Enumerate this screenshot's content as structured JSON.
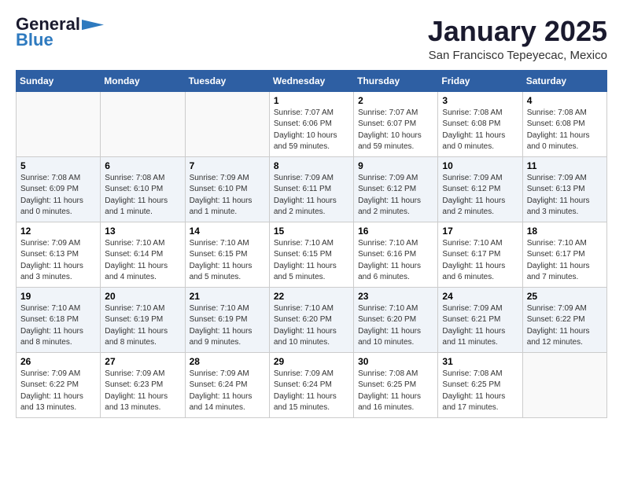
{
  "header": {
    "logo_line1": "General",
    "logo_line2": "Blue",
    "month": "January 2025",
    "location": "San Francisco Tepeyecac, Mexico"
  },
  "days_of_week": [
    "Sunday",
    "Monday",
    "Tuesday",
    "Wednesday",
    "Thursday",
    "Friday",
    "Saturday"
  ],
  "weeks": [
    [
      {
        "day": "",
        "info": ""
      },
      {
        "day": "",
        "info": ""
      },
      {
        "day": "",
        "info": ""
      },
      {
        "day": "1",
        "info": "Sunrise: 7:07 AM\nSunset: 6:06 PM\nDaylight: 10 hours\nand 59 minutes."
      },
      {
        "day": "2",
        "info": "Sunrise: 7:07 AM\nSunset: 6:07 PM\nDaylight: 10 hours\nand 59 minutes."
      },
      {
        "day": "3",
        "info": "Sunrise: 7:08 AM\nSunset: 6:08 PM\nDaylight: 11 hours\nand 0 minutes."
      },
      {
        "day": "4",
        "info": "Sunrise: 7:08 AM\nSunset: 6:08 PM\nDaylight: 11 hours\nand 0 minutes."
      }
    ],
    [
      {
        "day": "5",
        "info": "Sunrise: 7:08 AM\nSunset: 6:09 PM\nDaylight: 11 hours\nand 0 minutes."
      },
      {
        "day": "6",
        "info": "Sunrise: 7:08 AM\nSunset: 6:10 PM\nDaylight: 11 hours\nand 1 minute."
      },
      {
        "day": "7",
        "info": "Sunrise: 7:09 AM\nSunset: 6:10 PM\nDaylight: 11 hours\nand 1 minute."
      },
      {
        "day": "8",
        "info": "Sunrise: 7:09 AM\nSunset: 6:11 PM\nDaylight: 11 hours\nand 2 minutes."
      },
      {
        "day": "9",
        "info": "Sunrise: 7:09 AM\nSunset: 6:12 PM\nDaylight: 11 hours\nand 2 minutes."
      },
      {
        "day": "10",
        "info": "Sunrise: 7:09 AM\nSunset: 6:12 PM\nDaylight: 11 hours\nand 2 minutes."
      },
      {
        "day": "11",
        "info": "Sunrise: 7:09 AM\nSunset: 6:13 PM\nDaylight: 11 hours\nand 3 minutes."
      }
    ],
    [
      {
        "day": "12",
        "info": "Sunrise: 7:09 AM\nSunset: 6:13 PM\nDaylight: 11 hours\nand 3 minutes."
      },
      {
        "day": "13",
        "info": "Sunrise: 7:10 AM\nSunset: 6:14 PM\nDaylight: 11 hours\nand 4 minutes."
      },
      {
        "day": "14",
        "info": "Sunrise: 7:10 AM\nSunset: 6:15 PM\nDaylight: 11 hours\nand 5 minutes."
      },
      {
        "day": "15",
        "info": "Sunrise: 7:10 AM\nSunset: 6:15 PM\nDaylight: 11 hours\nand 5 minutes."
      },
      {
        "day": "16",
        "info": "Sunrise: 7:10 AM\nSunset: 6:16 PM\nDaylight: 11 hours\nand 6 minutes."
      },
      {
        "day": "17",
        "info": "Sunrise: 7:10 AM\nSunset: 6:17 PM\nDaylight: 11 hours\nand 6 minutes."
      },
      {
        "day": "18",
        "info": "Sunrise: 7:10 AM\nSunset: 6:17 PM\nDaylight: 11 hours\nand 7 minutes."
      }
    ],
    [
      {
        "day": "19",
        "info": "Sunrise: 7:10 AM\nSunset: 6:18 PM\nDaylight: 11 hours\nand 8 minutes."
      },
      {
        "day": "20",
        "info": "Sunrise: 7:10 AM\nSunset: 6:19 PM\nDaylight: 11 hours\nand 8 minutes."
      },
      {
        "day": "21",
        "info": "Sunrise: 7:10 AM\nSunset: 6:19 PM\nDaylight: 11 hours\nand 9 minutes."
      },
      {
        "day": "22",
        "info": "Sunrise: 7:10 AM\nSunset: 6:20 PM\nDaylight: 11 hours\nand 10 minutes."
      },
      {
        "day": "23",
        "info": "Sunrise: 7:10 AM\nSunset: 6:20 PM\nDaylight: 11 hours\nand 10 minutes."
      },
      {
        "day": "24",
        "info": "Sunrise: 7:09 AM\nSunset: 6:21 PM\nDaylight: 11 hours\nand 11 minutes."
      },
      {
        "day": "25",
        "info": "Sunrise: 7:09 AM\nSunset: 6:22 PM\nDaylight: 11 hours\nand 12 minutes."
      }
    ],
    [
      {
        "day": "26",
        "info": "Sunrise: 7:09 AM\nSunset: 6:22 PM\nDaylight: 11 hours\nand 13 minutes."
      },
      {
        "day": "27",
        "info": "Sunrise: 7:09 AM\nSunset: 6:23 PM\nDaylight: 11 hours\nand 13 minutes."
      },
      {
        "day": "28",
        "info": "Sunrise: 7:09 AM\nSunset: 6:24 PM\nDaylight: 11 hours\nand 14 minutes."
      },
      {
        "day": "29",
        "info": "Sunrise: 7:09 AM\nSunset: 6:24 PM\nDaylight: 11 hours\nand 15 minutes."
      },
      {
        "day": "30",
        "info": "Sunrise: 7:08 AM\nSunset: 6:25 PM\nDaylight: 11 hours\nand 16 minutes."
      },
      {
        "day": "31",
        "info": "Sunrise: 7:08 AM\nSunset: 6:25 PM\nDaylight: 11 hours\nand 17 minutes."
      },
      {
        "day": "",
        "info": ""
      }
    ]
  ]
}
